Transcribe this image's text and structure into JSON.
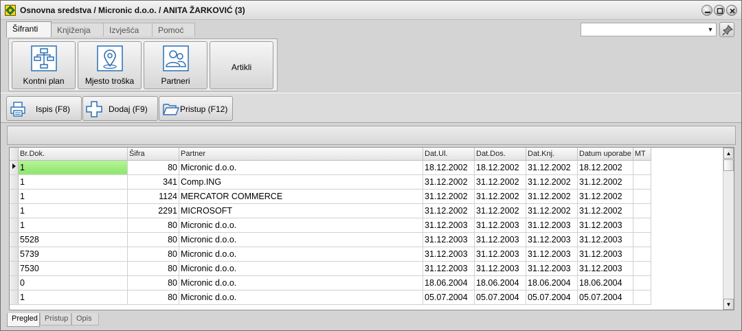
{
  "window": {
    "title": "Osnovna sredstva / Micronic d.o.o. / ANITA ŽARKOVIĆ (3)"
  },
  "menu_tabs": [
    {
      "label": "Šifranti",
      "active": true
    },
    {
      "label": "Knjiženja",
      "active": false
    },
    {
      "label": "Izvješća",
      "active": false
    },
    {
      "label": "Pomoć",
      "active": false
    }
  ],
  "top_combo": {
    "value": ""
  },
  "ribbon": {
    "buttons": [
      {
        "label": "Kontni plan",
        "icon": "hierarchy-chart-icon"
      },
      {
        "label": "Mjesto troška",
        "icon": "map-pin-icon"
      },
      {
        "label": "Partneri",
        "icon": "people-icon"
      },
      {
        "label": "Artikli",
        "icon": ""
      }
    ]
  },
  "toolbar": {
    "print_label": "Ispis (F8)",
    "add_label": "Dodaj (F9)",
    "access_label": "Pristup (F12)"
  },
  "grid": {
    "columns": [
      "Br.Dok.",
      "Šifra",
      "Partner",
      "Dat.Ul.",
      "Dat.Dos.",
      "Dat.Knj.",
      "Datum uporabe",
      "MT"
    ],
    "rows": [
      [
        "1",
        "80",
        "Micronic d.o.o.",
        "18.12.2002",
        "18.12.2002",
        "31.12.2002",
        "18.12.2002",
        ""
      ],
      [
        "1",
        "341",
        "Comp.ING",
        "31.12.2002",
        "31.12.2002",
        "31.12.2002",
        "31.12.2002",
        ""
      ],
      [
        "1",
        "1124",
        "MERCATOR COMMERCE",
        "31.12.2002",
        "31.12.2002",
        "31.12.2002",
        "31.12.2002",
        ""
      ],
      [
        "1",
        "2291",
        "MICROSOFT",
        "31.12.2002",
        "31.12.2002",
        "31.12.2002",
        "31.12.2002",
        ""
      ],
      [
        "1",
        "80",
        "Micronic d.o.o.",
        "31.12.2003",
        "31.12.2003",
        "31.12.2003",
        "31.12.2003",
        ""
      ],
      [
        "5528",
        "80",
        "Micronic d.o.o.",
        "31.12.2003",
        "31.12.2003",
        "31.12.2003",
        "31.12.2003",
        ""
      ],
      [
        "5739",
        "80",
        "Micronic d.o.o.",
        "31.12.2003",
        "31.12.2003",
        "31.12.2003",
        "31.12.2003",
        ""
      ],
      [
        "7530",
        "80",
        "Micronic d.o.o.",
        "31.12.2003",
        "31.12.2003",
        "31.12.2003",
        "31.12.2003",
        ""
      ],
      [
        "0",
        "80",
        "Micronic d.o.o.",
        "18.06.2004",
        "18.06.2004",
        "18.06.2004",
        "18.06.2004",
        ""
      ],
      [
        "1",
        "80",
        "Micronic d.o.o.",
        "05.07.2004",
        "05.07.2004",
        "05.07.2004",
        "05.07.2004",
        ""
      ]
    ],
    "selected_row": 0
  },
  "bottom_tabs": [
    {
      "label": "Pregled",
      "active": true
    },
    {
      "label": "Pristup",
      "active": false
    },
    {
      "label": "Opis",
      "active": false
    }
  ],
  "colors": {
    "selection": "#8fe46a",
    "icon_blue": "#2a6fb3"
  }
}
